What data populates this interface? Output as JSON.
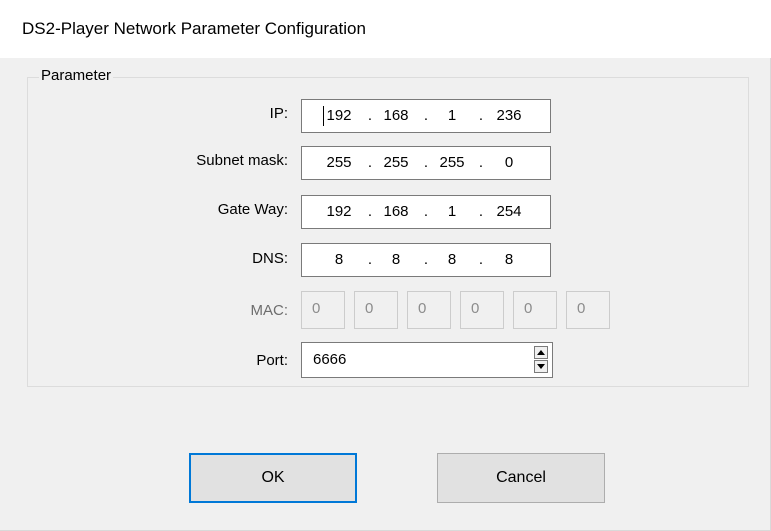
{
  "window": {
    "title": "DS2-Player Network Parameter Configuration"
  },
  "group": {
    "label": "Parameter"
  },
  "fields": {
    "ip": {
      "label": "IP:",
      "octets": [
        "192",
        "168",
        "1",
        "236"
      ]
    },
    "subnet": {
      "label": "Subnet mask:",
      "octets": [
        "255",
        "255",
        "255",
        "0"
      ]
    },
    "gateway": {
      "label": "Gate Way:",
      "octets": [
        "192",
        "168",
        "1",
        "254"
      ]
    },
    "dns": {
      "label": "DNS:",
      "octets": [
        "8",
        "8",
        "8",
        "8"
      ]
    },
    "mac": {
      "label": "MAC:",
      "values": [
        "0",
        "0",
        "0",
        "0",
        "0",
        "0"
      ],
      "enabled": false
    },
    "port": {
      "label": "Port:",
      "value": "6666"
    }
  },
  "ip_separator": ".",
  "buttons": {
    "ok": "OK",
    "cancel": "Cancel"
  },
  "colors": {
    "default_button_border": "#0078d7",
    "title_bar_bg": "#ffffff",
    "dialog_bg": "#f0f0f0"
  }
}
